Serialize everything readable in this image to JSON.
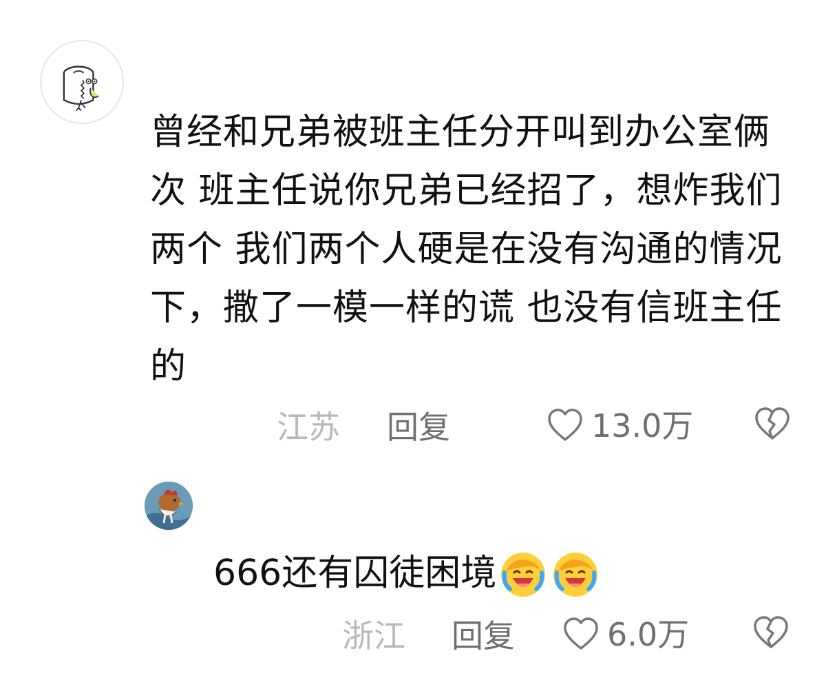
{
  "comment": {
    "text": "曾经和兄弟被班主任分开叫到办公室俩次 班主任说你兄弟已经招了，想炸我们两个 我们两个人硬是在没有沟通的情况下，撒了一模一样的谎 也没有信班主任的",
    "location": "江苏",
    "reply_label": "回复",
    "likes": "13.0万",
    "avatar_icon": "toilet-paper-avatar"
  },
  "reply": {
    "text": "666还有囚徒困境",
    "emojis": [
      "crying-laughing-emoji",
      "crying-laughing-emoji"
    ],
    "location": "浙江",
    "reply_label": "回复",
    "likes": "6.0万",
    "avatar_icon": "rooster-avatar"
  },
  "colors": {
    "text": "#111111",
    "location": "#b8b8b8",
    "action": "#6f6f6f"
  }
}
